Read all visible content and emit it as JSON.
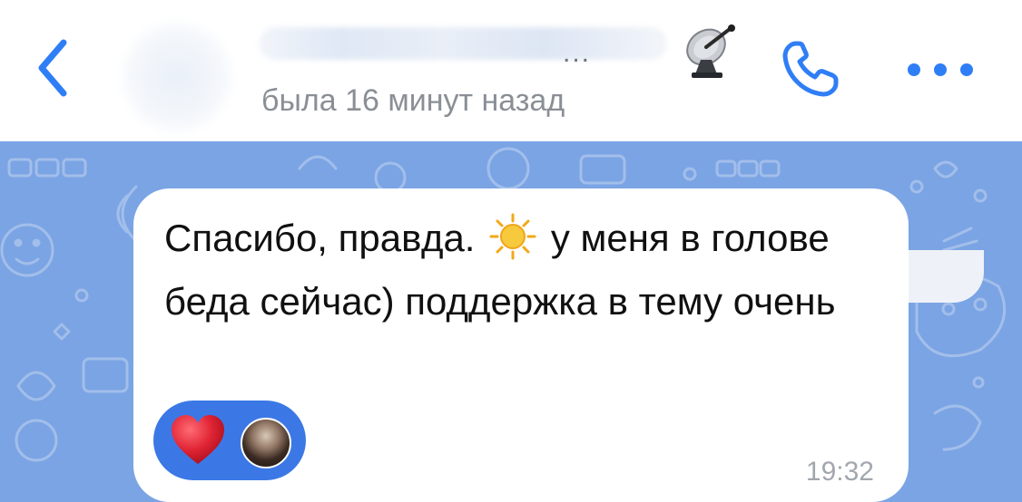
{
  "header": {
    "back_icon": "chevron-left-icon",
    "contact_name_suffix": "...",
    "status": "была 16 минут назад",
    "satellite_icon": "satellite-antenna-emoji",
    "call_icon": "phone-icon",
    "more_icon": "more-dots-icon"
  },
  "message": {
    "text_part1": "Спасибо, правда.",
    "emoji": "sun-emoji",
    "text_part2": "у меня в голове беда сейчас) поддержка в тему очень",
    "time": "19:32",
    "reaction": {
      "emoji": "red-heart",
      "reactor": "avatar"
    }
  },
  "colors": {
    "accent": "#2f7ef6",
    "wallpaper": "#7ba4e4",
    "bubble": "#ffffff",
    "reaction_pill": "#3b78e6",
    "heart": "#e02434",
    "status_text": "#8a8f96"
  }
}
